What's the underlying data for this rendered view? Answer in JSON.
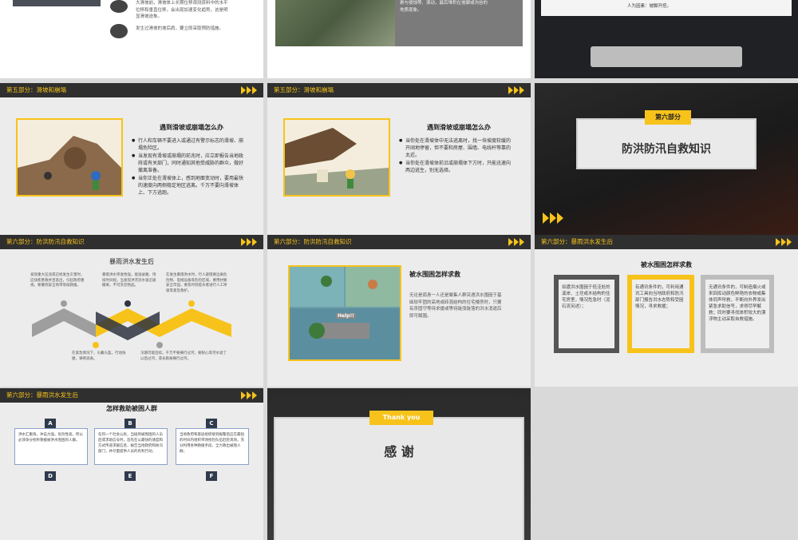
{
  "slides": {
    "s1": {
      "line1": "大滑坡前，滑坡体上长期位移观测资料中的水平",
      "line2": "位移和垂直位移，会出现加速变化趋势，这是明",
      "line3": "显滑坡迹象。",
      "line4": "发生过滑坡的坡后肩，要立即采取预防措施。"
    },
    "s2": {
      "line1": "裹与侵蚀等、滚动，最后堆积在坡脚或沟谷的",
      "line2": "地质现象。"
    },
    "s3": {
      "line1": "人为因素：坡脚开挖。"
    },
    "s4": {
      "header": "第五部分：滑坡和崩塌",
      "title": "遇到滑坡或崩塌怎么办",
      "bullets": [
        "行人和车辆不要进入或通过有警示标志的滑坡、崩塌危险区。",
        "当发现有滑坡或崩塌的前兆时，应立即报告当地政府或有关部门，同时通知其他受威胁的群众，做好撤离准备。",
        "当你正处在滑坡体上，感到地面变动时，要用最快的速度向两侧稳定地区逃离。千万不要向滑坡体上、下方逃跑。"
      ]
    },
    "s5": {
      "header": "第五部分：滑坡和崩塌",
      "title": "遇到滑坡或崩塌怎么办",
      "bullets": [
        "当你处在滑坡体中无法逃离时，找一块坡度较缓的开阔地停留，但不要和房屋、围墙、电线杆等靠的太近。",
        "当你处在滑坡体前沿或崩塌体下方时，只能迅速向两边逃生，别无选择。"
      ]
    },
    "s6": {
      "badge": "第六部分",
      "title": "防洪防汛自救知识"
    },
    "s7": {
      "header": "第六部分：防洪防汛自救知识",
      "title": "暴雨洪水发生后",
      "t1": "发现重大征兆或已经发生灾害时，应快疾勇救并且逃出，引起政府重视，要撤到安全地带等候救援。",
      "t2": "暴雨洪水突发性强，能张驶路、持续时间短，当发现洪涝流水速迅速撤离，不可贪恋物品。",
      "t3": "在发生暴雨洪水时，行人避雨要远离危险物、电线设备等危险区域，要用材要安全牢固，要及时到提水者进行人工呼吸等紧急救护。",
      "t4": "在紧急情况下，头戴头盔，行动快捷，果断逃离。",
      "t5": "汛期可能连续，千万不要横行过河，要耐心等河水退了以后过河，或长跑离横行过河。"
    },
    "s8": {
      "header": "第六部分：防洪防汛自救知识",
      "title": "被水围困怎样求救",
      "body": "无论是孤身一人还是聚集人群突遇洪水围困于基础较牢固的高地或砖混结构的住宅楼房时，只要有序固守等待求援或等待陡涨陡落的洪水消退后即可解围。",
      "help": "Help!!"
    },
    "s9": {
      "header": "第六部分：暴雨洪水发生后",
      "title": "被水围困怎样求救",
      "c1": "如遭洪水围困于低洼处的溪岸、土坯或木结构的住宅房里，情况危急时（泥石流另述）；",
      "c2": "有通讯条件的，可利用通讯工具向当地政府和防汛部门报告洪水态势和受困情况，寻求救援；",
      "c3": "无通讯条件的，可制造烟火或来回挥动颜色鲜艳的衣物或集体同声呼救，不断向外界发出紧急求助信号，求得尽早解救；同时要寻找体积较大的漂浮物主动采取自救措施。"
    },
    "s10": {
      "header": "第六部分：暴雨洪水发生后",
      "title": "怎样救助被困人群",
      "labels": [
        "A",
        "B",
        "C",
        "D",
        "E",
        "F"
      ],
      "a": "洪水汇集快，冲击力强，危险性高，所以必须争分抢秒救援被洪水围困的人群。",
      "b": "任何一个社会公民，当碰到被围困的人员后或求助信号时，首先在以最快的速度和方式传递求援信息，报告当地政府和防汛部门，并尽量提供人员的有利行动；",
      "c": "当地政府和基层组织接到报警后应在最短的时间内组织带领抢险队伍赶赴现场，充分利用各种救援手段，全力救出被围人群；"
    },
    "s11": {
      "badge": "Thank you",
      "title": "感 谢"
    }
  },
  "colors": {
    "accent": "#f7c31b",
    "dark": "#2f2f2f",
    "navy": "#2f3b4c"
  }
}
